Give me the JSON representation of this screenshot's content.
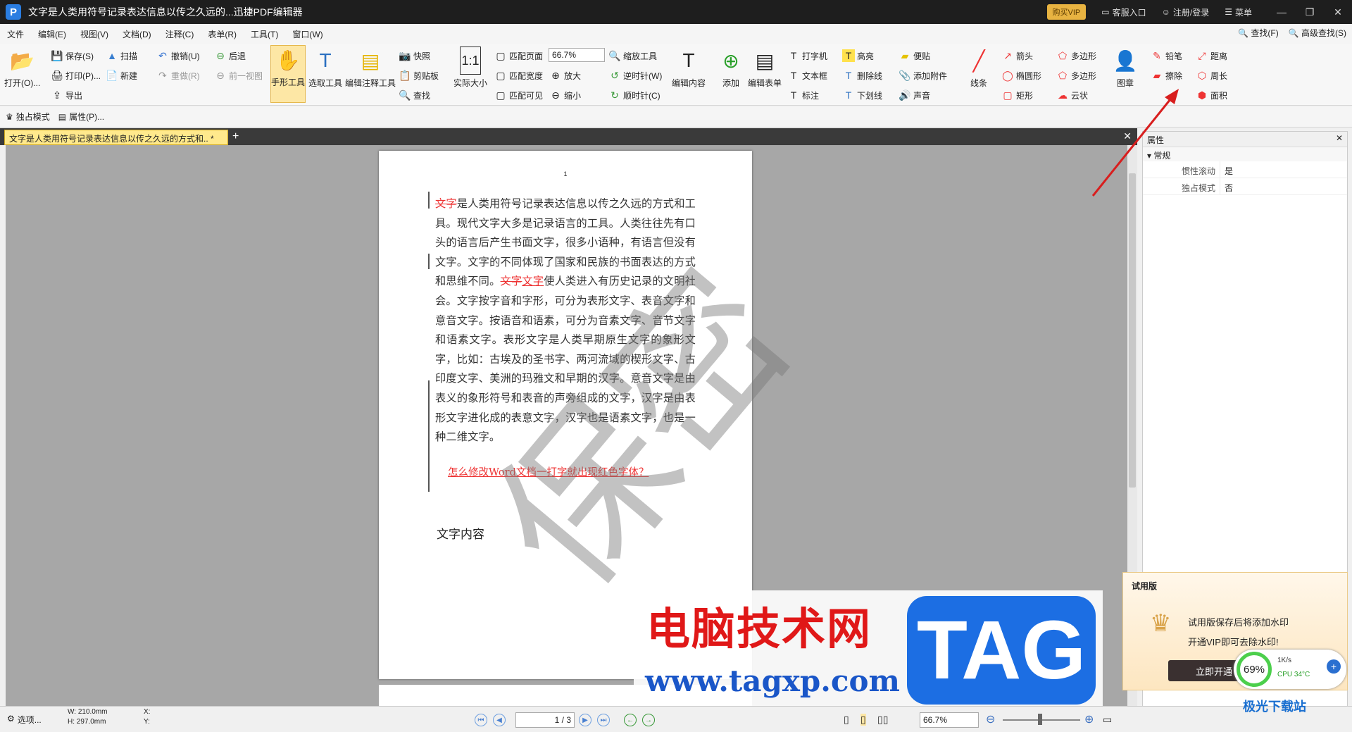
{
  "title": {
    "text": "文字是人类用符号记录表达信息以传之久远的...迅捷PDF编辑器",
    "vip": "购买VIP",
    "service": "客服入口",
    "login": "注册/登录",
    "menu": "菜单"
  },
  "menubar": {
    "items": [
      "文件",
      "编辑(E)",
      "视图(V)",
      "文档(D)",
      "注释(C)",
      "表单(R)",
      "工具(T)",
      "窗口(W)"
    ],
    "find": "查找(F)",
    "adv_find": "高级查找(S)"
  },
  "ribbon": {
    "open": "打开(O)...",
    "save": "保存(S)",
    "print": "打印(P)...",
    "export": "导出",
    "scan": "扫描",
    "new": "新建",
    "undo": "撤销(U)",
    "redo": "重做(R)",
    "back": "后退",
    "prev_view": "前一视图",
    "hand": "手形工具",
    "select": "选取工具",
    "edit_note": "编辑注释工具",
    "snapshot": "快照",
    "clipboard": "剪贴板",
    "find": "查找",
    "actual": "实际大小",
    "fit_page": "匹配页面",
    "fit_width": "匹配宽度",
    "fit_visible": "匹配可见",
    "zoom": "66.7%",
    "zoom_in": "放大",
    "zoom_out": "缩小",
    "zoom_tool": "缩放工具",
    "ccw": "逆时针(W)",
    "cw": "顺时针(C)",
    "edit_content": "编辑内容",
    "add": "添加",
    "edit_form": "编辑表单",
    "typewriter": "打字机",
    "textbox": "文本框",
    "callout": "标注",
    "highlight": "高亮",
    "strike": "删除线",
    "underline": "下划线",
    "note": "便贴",
    "attach": "添加附件",
    "sound": "声音",
    "line": "线条",
    "arrow": "箭头",
    "ellipse": "椭圆形",
    "rect": "矩形",
    "polygon": "多边形",
    "polyline": "多边形",
    "cloud": "云状",
    "stamp": "图章",
    "pencil": "铅笔",
    "eraser": "擦除",
    "distance": "距离",
    "perimeter": "周长",
    "area": "面积"
  },
  "subbar": {
    "exclusive": "独占模式",
    "props": "属性(P)..."
  },
  "tab": {
    "label": "文字是人类用符号记录表达信息以传之久远的方式和.. *"
  },
  "doc": {
    "page_num": "1",
    "p1a": "文字",
    "p1b": "是人类用符号记录表达信息以传之久远的方式和工具。现代文字大多是记录语言的工具。人类往往先有口头的语言后产生书面文字，很多小语种，有语言但没有文字。文字的不同体现了国家和民族的书面表达的方式和思维不同。",
    "p1c": "文字",
    "p1d": "文字",
    "p1e": "使人类进入有历史记录的文明社会。文字按字音和字形，可分为表形文字、表音文字和意音文字。按语音和语素，可分为音素文字、音节文字和语素文字。表形文字是人类早期原生文字的象形文字，比如：古埃及的圣书字、两河流域的楔形文字、古印度文字、美洲的玛雅文和早期的汉字。意音文字是由表义的象形符号和表音的声旁组成的文字，汉字是由表形文字进化成的表意文字，汉字也是语素文字，也是一种二维文字。",
    "link": "怎么修改Word文档一打字就出现红色字体？",
    "heading": "文字内容",
    "watermark": "保密"
  },
  "props": {
    "title": "属性",
    "group": "常规",
    "rows": [
      {
        "k": "惯性滚动",
        "v": "是"
      },
      {
        "k": "独占模式",
        "v": "否"
      }
    ]
  },
  "status": {
    "options": "选项...",
    "w": "W: 210.0mm",
    "h": "H: 297.0mm",
    "x": "X:",
    "y": "Y:",
    "page": "1 / 3",
    "zoom": "66.7%"
  },
  "trial": {
    "title": "试用版",
    "line1": "试用版保存后将添加水印",
    "line2": "开通VIP即可去除水印!",
    "btn": "立即开通",
    "cpu": "69%",
    "net": "1K/s",
    "cpu_temp": "CPU 34°C"
  },
  "site": {
    "cn": "电脑技术网",
    "url": "www.tagxp.com",
    "tag": "TAG",
    "corner": "极光下载站"
  }
}
